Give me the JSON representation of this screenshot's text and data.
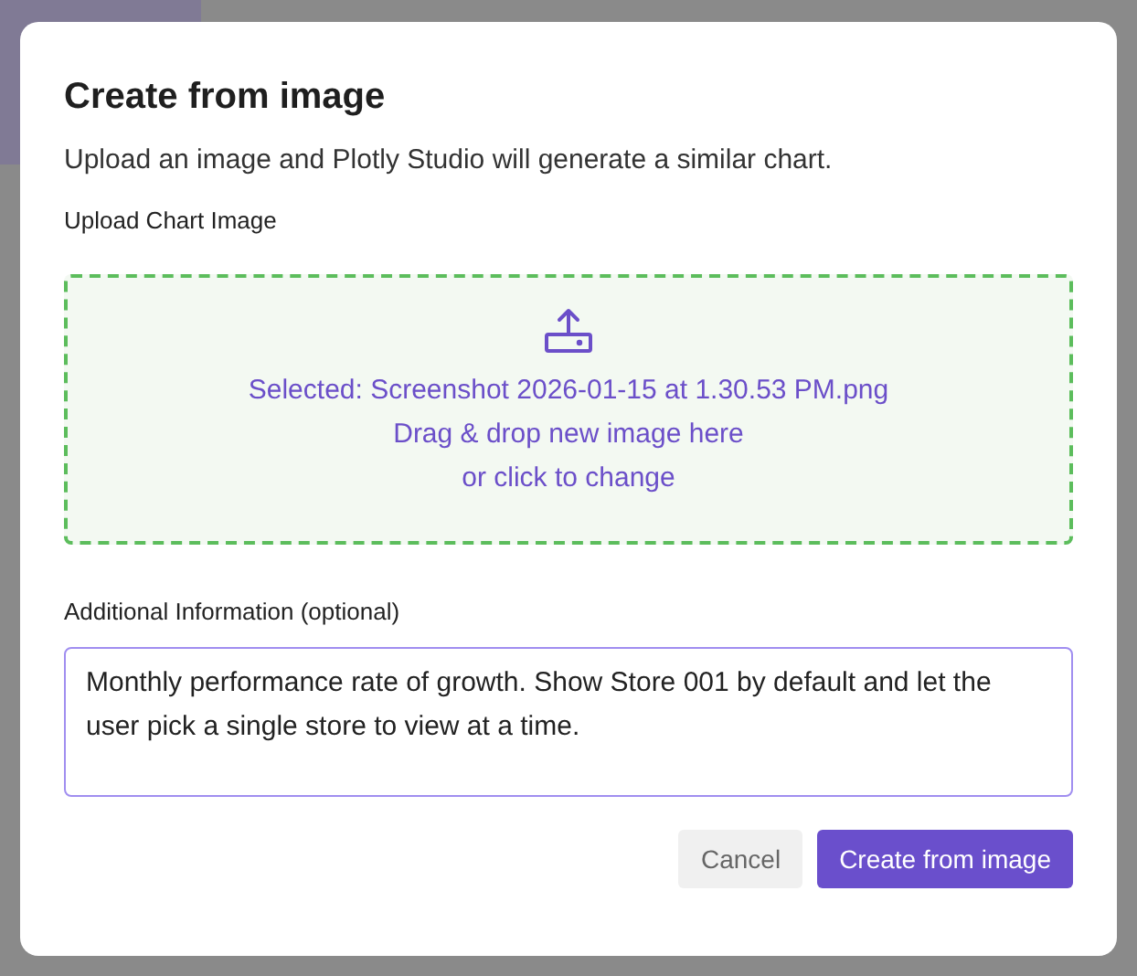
{
  "dialog": {
    "title": "Create from image",
    "description": "Upload an image and Plotly Studio will generate a similar chart.",
    "upload": {
      "label": "Upload Chart Image",
      "file_selected": true,
      "selected_text": "Selected: Screenshot 2026-01-15 at 1.30.53 PM.png",
      "hint_lines": [
        "Drag & drop new image here",
        "or click to change"
      ]
    },
    "additional": {
      "label": "Additional Information (optional)",
      "value": "Monthly performance rate of growth. Show Store 001 by default and let the user pick a single store to view at a time.",
      "focused": true
    },
    "buttons": [
      {
        "label": "Cancel",
        "kind": "secondary"
      },
      {
        "label": "Create from image",
        "kind": "primary"
      }
    ]
  }
}
